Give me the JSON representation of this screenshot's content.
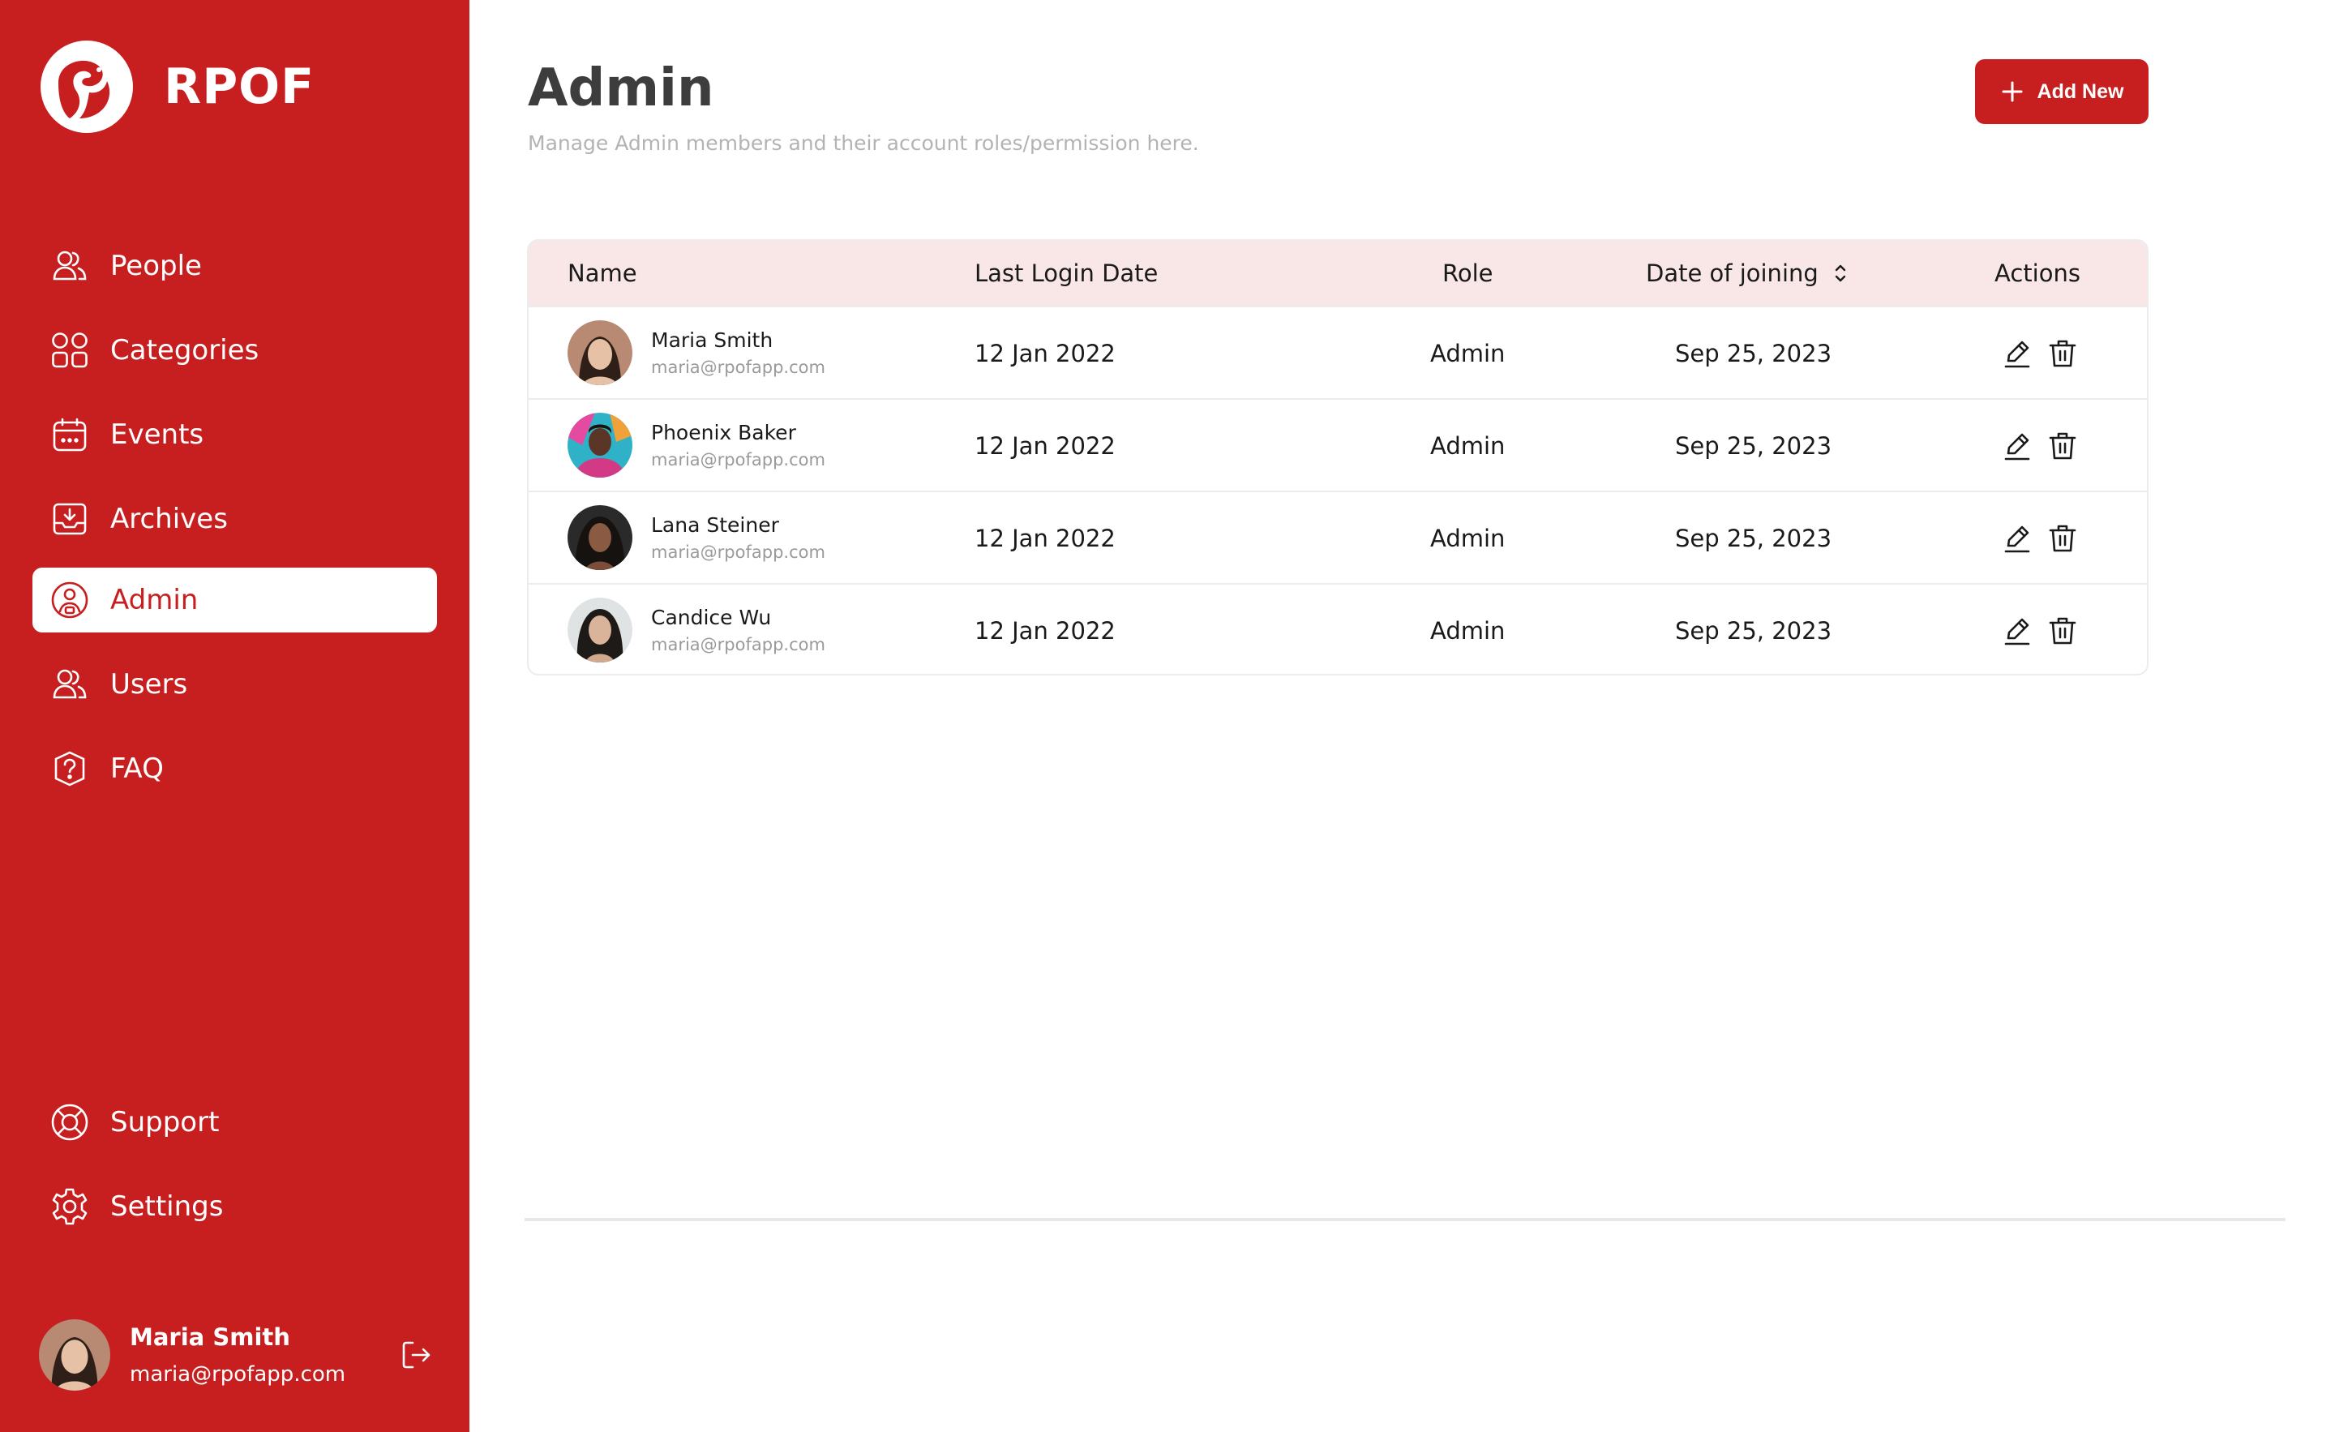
{
  "brand": {
    "name": "RPOF"
  },
  "nav": {
    "items": [
      {
        "label": "People",
        "icon": "users-icon"
      },
      {
        "label": "Categories",
        "icon": "grid-icon"
      },
      {
        "label": "Events",
        "icon": "calendar-icon"
      },
      {
        "label": "Archives",
        "icon": "archive-download-icon"
      },
      {
        "label": "Admin",
        "icon": "admin-user-icon",
        "active": true
      },
      {
        "label": "Users",
        "icon": "users-icon"
      },
      {
        "label": "FAQ",
        "icon": "help-circle-icon"
      }
    ],
    "bottom": [
      {
        "label": "Support",
        "icon": "lifebuoy-icon"
      },
      {
        "label": "Settings",
        "icon": "gear-icon"
      }
    ]
  },
  "current_user": {
    "name": "Maria Smith",
    "email": "maria@rpofapp.com"
  },
  "header": {
    "title": "Admin",
    "subtitle": "Manage Admin members and their account roles/permission here.",
    "add_button_label": "Add New"
  },
  "table": {
    "columns": [
      "Name",
      "Last Login Date",
      "Role",
      "Date of joining",
      "Actions"
    ],
    "rows": [
      {
        "name": "Maria Smith",
        "email": "maria@rpofapp.com",
        "last_login": "12 Jan 2022",
        "role": "Admin",
        "joined": "Sep 25, 2023"
      },
      {
        "name": "Phoenix Baker",
        "email": "maria@rpofapp.com",
        "last_login": "12 Jan 2022",
        "role": "Admin",
        "joined": "Sep 25, 2023"
      },
      {
        "name": "Lana Steiner",
        "email": "maria@rpofapp.com",
        "last_login": "12 Jan 2022",
        "role": "Admin",
        "joined": "Sep 25, 2023"
      },
      {
        "name": "Candice Wu",
        "email": "maria@rpofapp.com",
        "last_login": "12 Jan 2022",
        "role": "Admin",
        "joined": "Sep 25, 2023"
      }
    ]
  },
  "colors": {
    "brand_red": "#c71f1f",
    "header_row_bg": "#f9e6e6",
    "white": "#ffffff"
  }
}
